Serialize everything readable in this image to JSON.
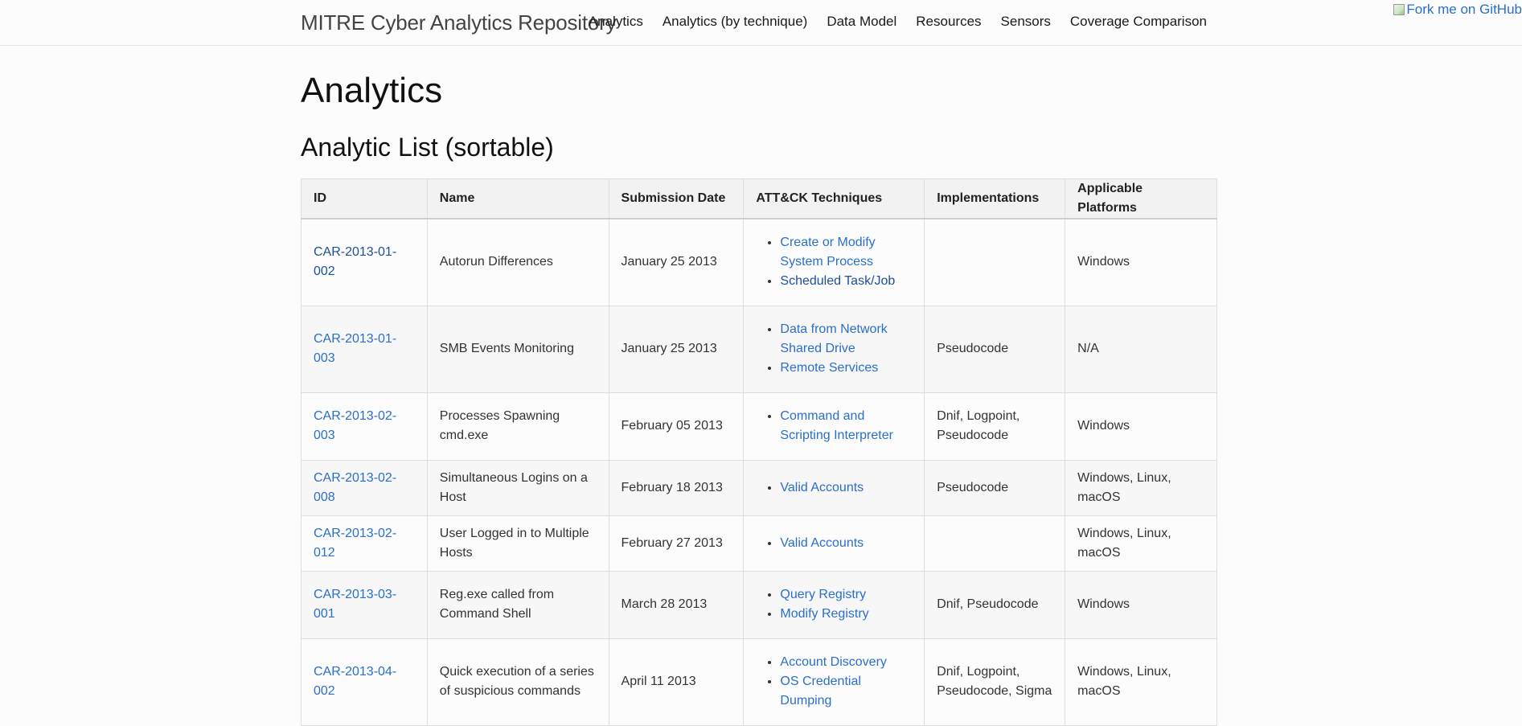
{
  "navbar": {
    "brand": "MITRE Cyber Analytics Repository",
    "items": [
      {
        "label": "Analytics"
      },
      {
        "label": "Analytics (by technique)"
      },
      {
        "label": "Data Model"
      },
      {
        "label": "Resources"
      },
      {
        "label": "Sensors"
      },
      {
        "label": "Coverage Comparison"
      }
    ],
    "fork_label": "Fork me on GitHub"
  },
  "page": {
    "title": "Analytics",
    "section_title": "Analytic List (sortable)"
  },
  "table": {
    "headers": [
      "ID",
      "Name",
      "Submission Date",
      "ATT&CK Techniques",
      "Implementations",
      "Applicable Platforms"
    ],
    "rows": [
      {
        "id": "CAR-2013-01-002",
        "name": "Autorun Differences",
        "date": "January 25 2013",
        "techniques": [
          "Create or Modify System Process",
          "Scheduled Task/Job"
        ],
        "implementations": "",
        "platforms": "Windows"
      },
      {
        "id": "CAR-2013-01-003",
        "name": "SMB Events Monitoring",
        "date": "January 25 2013",
        "techniques": [
          "Data from Network Shared Drive",
          "Remote Services"
        ],
        "implementations": "Pseudocode",
        "platforms": "N/A"
      },
      {
        "id": "CAR-2013-02-003",
        "name": "Processes Spawning cmd.exe",
        "date": "February 05 2013",
        "techniques": [
          "Command and Scripting Interpreter"
        ],
        "implementations": "Dnif, Logpoint, Pseudocode",
        "platforms": "Windows"
      },
      {
        "id": "CAR-2013-02-008",
        "name": "Simultaneous Logins on a Host",
        "date": "February 18 2013",
        "techniques": [
          "Valid Accounts"
        ],
        "implementations": "Pseudocode",
        "platforms": "Windows, Linux, macOS"
      },
      {
        "id": "CAR-2013-02-012",
        "name": "User Logged in to Multiple Hosts",
        "date": "February 27 2013",
        "techniques": [
          "Valid Accounts"
        ],
        "implementations": "",
        "platforms": "Windows, Linux, macOS"
      },
      {
        "id": "CAR-2013-03-001",
        "name": "Reg.exe called from Command Shell",
        "date": "March 28 2013",
        "techniques": [
          "Query Registry",
          "Modify Registry"
        ],
        "implementations": "Dnif, Pseudocode",
        "platforms": "Windows"
      },
      {
        "id": "CAR-2013-04-002",
        "name": "Quick execution of a series of suspicious commands",
        "date": "April 11 2013",
        "techniques": [
          "Account Discovery",
          "OS Credential Dumping"
        ],
        "implementations": "Dnif, Logpoint, Pseudocode, Sigma",
        "platforms": "Windows, Linux, macOS"
      }
    ]
  },
  "colors": {
    "link": "#2a6fc9",
    "link_visited": "#1f4f99",
    "header_bg": "#f2f2f2",
    "stripe_bg": "#f7f7f7"
  }
}
